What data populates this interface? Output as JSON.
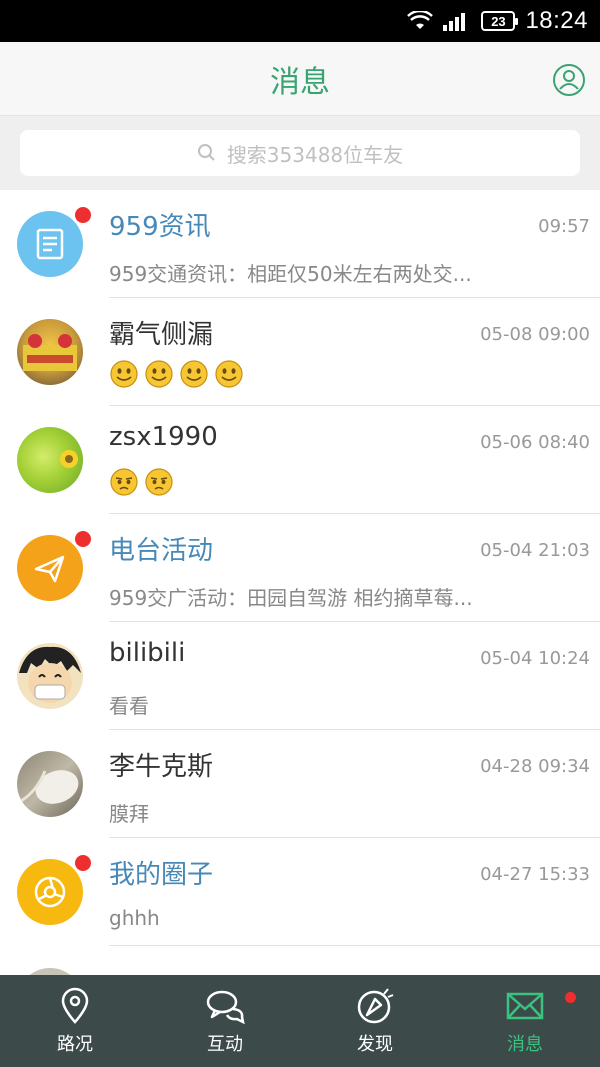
{
  "status_bar": {
    "time": "18:24",
    "battery": "23"
  },
  "header": {
    "title": "消息"
  },
  "search": {
    "placeholder": "搜索353488位车友"
  },
  "conversations": [
    {
      "name": "959资讯",
      "time": "09:57",
      "preview": "959交通资讯：相距仅50米左右两处交...",
      "official": true,
      "unread": true
    },
    {
      "name": "霸气侧漏",
      "time": "05-08 09:00",
      "preview_emoji_count": 4,
      "official": false,
      "unread": false
    },
    {
      "name": "zsx1990",
      "time": "05-06 08:40",
      "preview_emoji_count": 2,
      "official": false,
      "unread": false
    },
    {
      "name": "电台活动",
      "time": "05-04 21:03",
      "preview": "959交广活动：田园自驾游 相约摘草莓...",
      "official": true,
      "unread": true
    },
    {
      "name": "bilibili",
      "time": "05-04 10:24",
      "preview": "看看",
      "official": false,
      "unread": false
    },
    {
      "name": "李牛克斯",
      "time": "04-28 09:34",
      "preview": "膜拜",
      "official": false,
      "unread": false
    },
    {
      "name": "我的圈子",
      "time": "04-27 15:33",
      "preview": "ghhh",
      "official": true,
      "unread": true
    }
  ],
  "tabs": [
    {
      "label": "路况",
      "icon": "location-pin-icon"
    },
    {
      "label": "互动",
      "icon": "chat-bubbles-icon"
    },
    {
      "label": "发现",
      "icon": "discover-icon"
    },
    {
      "label": "消息",
      "icon": "envelope-icon",
      "active": true,
      "badge": true
    }
  ],
  "colors": {
    "accent": "#3aa372",
    "official_name": "#4689b8",
    "badge": "#ee2f2f",
    "tab_bg": "#3d4a4a"
  }
}
